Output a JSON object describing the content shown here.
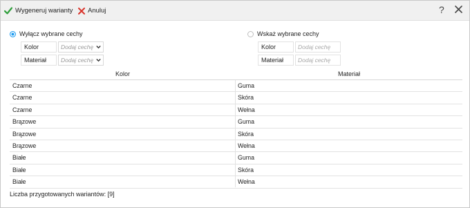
{
  "toolbar": {
    "generate_label": "Wygeneruj warianty",
    "cancel_label": "Anuluj",
    "help_label": "?"
  },
  "left_panel": {
    "radio_label": "Wyłącz wybrane cechy",
    "selected": true,
    "fields": [
      {
        "label": "Kolor",
        "placeholder": "Dodaj cechę"
      },
      {
        "label": "Materiał",
        "placeholder": "Dodaj cechę"
      }
    ]
  },
  "right_panel": {
    "radio_label": "Wskaż wybrane cechy",
    "selected": false,
    "fields": [
      {
        "label": "Kolor",
        "placeholder": "Dodaj cechę"
      },
      {
        "label": "Materiał",
        "placeholder": "Dodaj cechę"
      }
    ]
  },
  "table": {
    "columns": [
      "Kolor",
      "Materiał"
    ],
    "rows": [
      [
        "Czarne",
        "Guma"
      ],
      [
        "Czarne",
        "Skóra"
      ],
      [
        "Czarne",
        "Wełna"
      ],
      [
        "Brązowe",
        "Guma"
      ],
      [
        "Brązowe",
        "Skóra"
      ],
      [
        "Brązowe",
        "Wełna"
      ],
      [
        "Białe",
        "Guma"
      ],
      [
        "Białe",
        "Skóra"
      ],
      [
        "Białe",
        "Wełna"
      ]
    ]
  },
  "status": {
    "text": "Liczba przygotowanych wariantów: [9]"
  },
  "colors": {
    "accent": "#1e9bf0",
    "check_green": "#2e9e3a",
    "cancel_red": "#d9342b"
  }
}
